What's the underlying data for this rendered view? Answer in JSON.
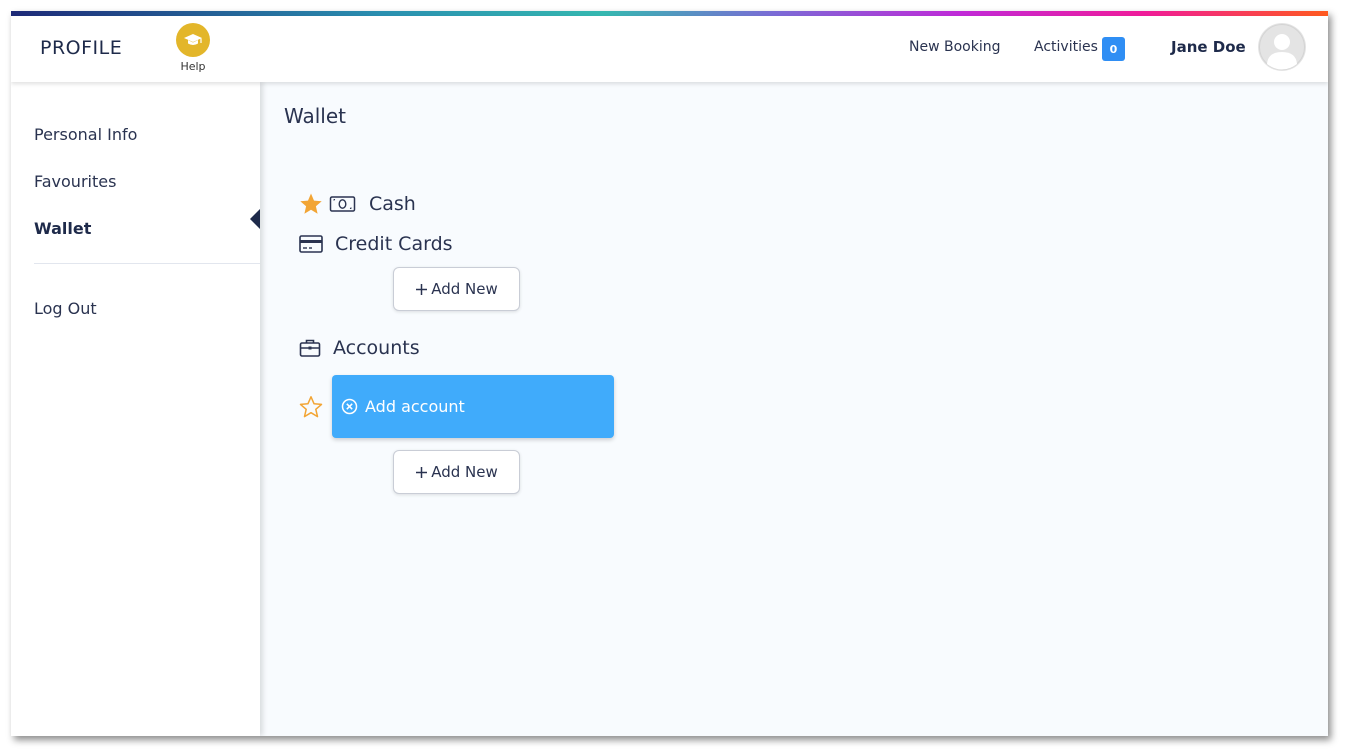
{
  "header": {
    "brand": "PROFILE",
    "help_label": "Help",
    "nav_new_booking": "New Booking",
    "nav_activities": "Activities",
    "activities_count": "0",
    "user_name": "Jane Doe"
  },
  "sidebar": {
    "items": [
      {
        "label": "Personal Info",
        "active": false
      },
      {
        "label": "Favourites",
        "active": false
      },
      {
        "label": "Wallet",
        "active": true
      }
    ],
    "logout_label": "Log Out"
  },
  "main": {
    "title": "Wallet",
    "cash": {
      "label": "Cash",
      "favourite": true
    },
    "credit_cards": {
      "label": "Credit Cards",
      "add_label": "Add New"
    },
    "accounts": {
      "label": "Accounts",
      "pending_item": {
        "label": "Add account",
        "favourite": false
      },
      "add_label": "Add New"
    }
  },
  "colors": {
    "accent_blue": "#40abfb",
    "badge_blue": "#2f8ef4",
    "star_gold": "#f2a535",
    "help_gold": "#e3b62a",
    "text_dark": "#1e2a4a"
  },
  "icons": {
    "help": "graduation-cap-icon",
    "avatar": "user-silhouette-icon",
    "cash": "banknote-icon",
    "credit_cards": "credit-card-icon",
    "accounts": "briefcase-icon",
    "favourite": "star-icon",
    "remove": "circle-x-icon",
    "add": "plus-icon"
  }
}
